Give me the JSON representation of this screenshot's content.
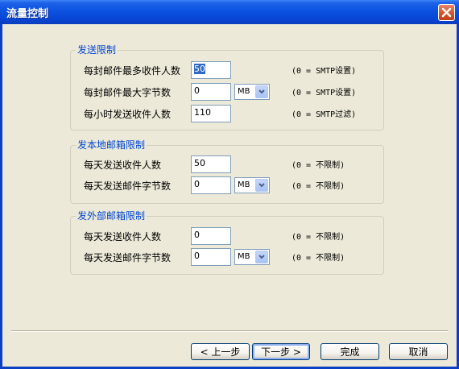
{
  "window": {
    "title": "流量控制"
  },
  "groups": [
    {
      "title": "发送限制",
      "rows": [
        {
          "label": "每封邮件最多收件人数",
          "value": "50",
          "selected": true,
          "note": "(0 = SMTP设置)"
        },
        {
          "label": "每封邮件最大字节数",
          "value": "0",
          "unit": "MB",
          "note": "(0 = SMTP设置)"
        },
        {
          "label": "每小时发送收件人数",
          "value": "110",
          "note": "(0 = SMTP过滤)"
        }
      ]
    },
    {
      "title": "发本地邮箱限制",
      "rows": [
        {
          "label": "每天发送收件人数",
          "value": "50",
          "note": "(0 = 不限制)"
        },
        {
          "label": "每天发送邮件字节数",
          "value": "0",
          "unit": "MB",
          "note": "(0 = 不限制)"
        }
      ]
    },
    {
      "title": "发外部邮箱限制",
      "rows": [
        {
          "label": "每天发送收件人数",
          "value": "0",
          "note": "(0 = 不限制)"
        },
        {
          "label": "每天发送邮件字节数",
          "value": "0",
          "unit": "MB",
          "note": "(0 = 不限制)"
        }
      ]
    }
  ],
  "buttons": {
    "back": "< 上一步",
    "next": "下一步 >",
    "finish": "完成",
    "cancel": "取消"
  },
  "icons": {
    "close": "close-icon",
    "dropdown": "chevron-down-icon"
  },
  "colors": {
    "titlebar": "#0b52e0",
    "face": "#ece9d8",
    "group_title": "#0046d5",
    "close": "#d2542d"
  }
}
